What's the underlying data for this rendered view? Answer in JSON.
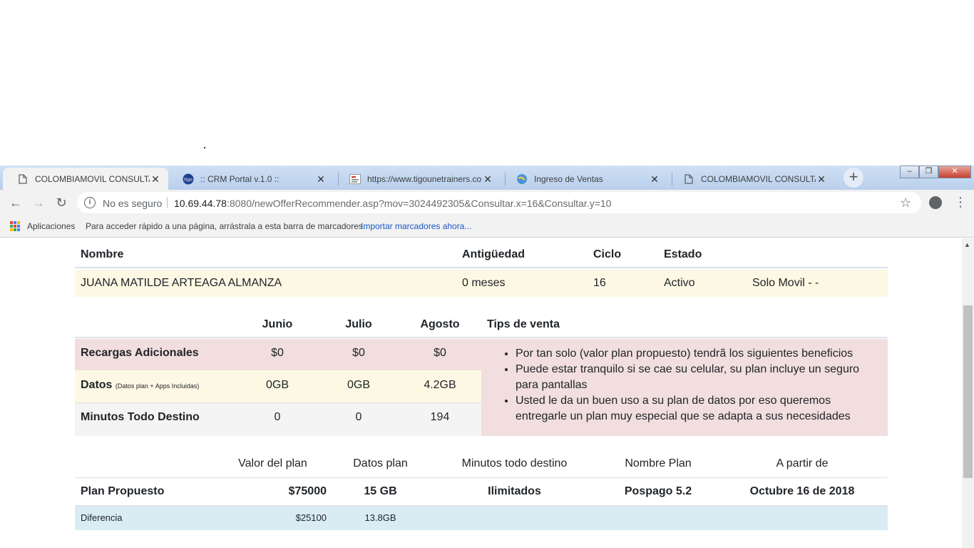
{
  "browser": {
    "tabs": [
      {
        "title": "COLOMBIAMOVIL CONSULTA IN",
        "favicon": "page-icon",
        "active": true
      },
      {
        "title": ":: CRM Portal v.1.0 ::",
        "favicon": "tigo-icon",
        "active": false
      },
      {
        "title": "https://www.tigounetrainers.com",
        "favicon": "site-icon",
        "active": false
      },
      {
        "title": "Ingreso de Ventas",
        "favicon": "globe-icon",
        "active": false
      },
      {
        "title": "COLOMBIAMOVIL CONSULTA IN",
        "favicon": "page-icon",
        "active": false
      }
    ],
    "tab_close": "✕",
    "new_tab": "+",
    "window_controls": {
      "minimize": "–",
      "restore": "❐",
      "close": "✕"
    },
    "address": {
      "security_label": "No es seguro",
      "host": "10.69.44.78",
      "rest": ":8080/newOfferRecommender.asp?mov=3024492305&Consultar.x=16&Consultar.y=10"
    },
    "bookmarks": {
      "apps_label": "Aplicaciones",
      "hint": "Para acceder rápido a una página, arrástrala a esta barra de marcadores.",
      "import_link": "Importar marcadores ahora..."
    }
  },
  "customer": {
    "headers": {
      "name": "Nombre",
      "tenure": "Antigüedad",
      "cycle": "Ciclo",
      "status": "Estado"
    },
    "name": "JUANA MATILDE ARTEAGA ALMANZA",
    "tenure": "0 meses",
    "cycle": "16",
    "status": "Activo",
    "extra": "Solo Movil - -"
  },
  "usage": {
    "months": [
      "Junio",
      "Julio",
      "Agosto"
    ],
    "tips_header": "Tips de venta",
    "rows": [
      {
        "label": "Recargas Adicionales",
        "note": "",
        "values": [
          "$0",
          "$0",
          "$0"
        ]
      },
      {
        "label": "Datos",
        "note": "(Datos plan + Apps Incluidas)",
        "values": [
          "0GB",
          "0GB",
          "4.2GB"
        ]
      },
      {
        "label": "Minutos Todo Destino",
        "note": "",
        "values": [
          "0",
          "0",
          "194"
        ]
      }
    ],
    "tips": [
      "Por tan solo (valor plan propuesto) tendrã los siguientes beneficios",
      "Puede estar tranquilo si se cae su celular, su plan incluye un seguro para pantallas",
      "Usted le da un buen uso a su plan de datos por eso queremos entregarle un plan muy especial que se adapta a sus necesidades"
    ]
  },
  "plan": {
    "headers": {
      "value": "Valor del plan",
      "data": "Datos plan",
      "minutes": "Minutos todo destino",
      "name": "Nombre Plan",
      "from": "A partir de"
    },
    "proposed": {
      "label": "Plan Propuesto",
      "value": "$75000",
      "data": "15 GB",
      "minutes": "Ilimitados",
      "name": "Pospago 5.2",
      "from": "Octubre 16 de 2018"
    },
    "difference": {
      "label": "Diferencia",
      "value": "$25100",
      "data": "13.8GB"
    }
  },
  "colors": {
    "yellow_row": "#fdf8e4",
    "pink_row": "#f2dede",
    "gray_row": "#f4f4f4",
    "blue_row": "#d9ecf4",
    "link": "#1a56c4"
  }
}
